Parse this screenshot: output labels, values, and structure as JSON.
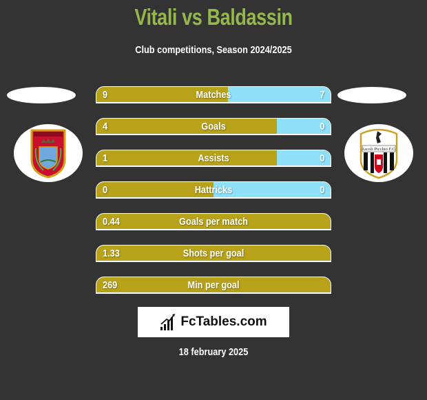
{
  "header": {
    "title": "Vitali vs Baldassin",
    "subtitle": "Club competitions, Season 2024/2025"
  },
  "teams": {
    "left": {
      "name": "Vitali",
      "logo": "crest-red-shield-icon"
    },
    "right": {
      "name": "Baldassin",
      "logo": "ascoli-picchio-fc-crest-icon"
    }
  },
  "colors": {
    "left_bar": "#b8a21a",
    "right_bar": "#8ee0f8",
    "title": "#94b84a",
    "background": "#333333"
  },
  "stats": [
    {
      "label": "Matches",
      "left": "9",
      "right": "7",
      "left_share": 0.5625
    },
    {
      "label": "Goals",
      "left": "4",
      "right": "0",
      "left_share": 0.77
    },
    {
      "label": "Assists",
      "left": "1",
      "right": "0",
      "left_share": 0.77
    },
    {
      "label": "Hattricks",
      "left": "0",
      "right": "0",
      "left_share": 0.5
    },
    {
      "label": "Goals per match",
      "left": "0.44",
      "right": null,
      "left_share": 1
    },
    {
      "label": "Shots per goal",
      "left": "1.33",
      "right": null,
      "left_share": 1
    },
    {
      "label": "Min per goal",
      "left": "269",
      "right": null,
      "left_share": 1
    }
  ],
  "footer": {
    "brand": "FcTables.com",
    "date": "18 february 2025"
  }
}
